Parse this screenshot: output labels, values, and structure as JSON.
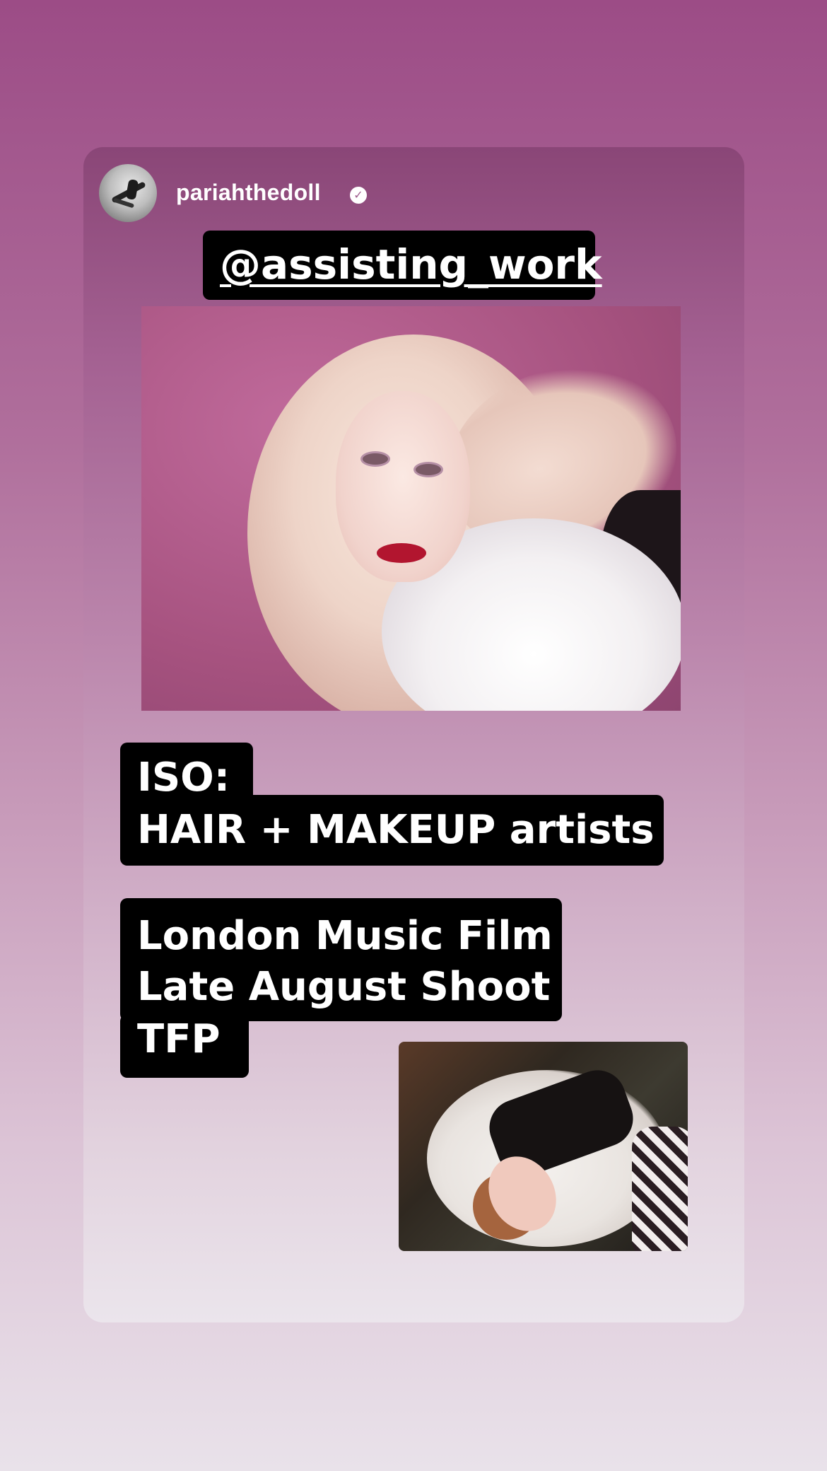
{
  "story": {
    "username": "pariahthedoll",
    "verified_icon": "verified-badge-icon",
    "mention": "@assisting_work",
    "iso_line1": "ISO:",
    "iso_line2": "HAIR + MAKEUP artists",
    "details_line1": "London Music Film",
    "details_line2": "Late August Shoot",
    "details_line3": "TFP"
  },
  "colors": {
    "background_top": "#9c4c86",
    "background_bottom": "#e9e2ea",
    "tag_background": "#000000",
    "tag_text": "#ffffff"
  }
}
